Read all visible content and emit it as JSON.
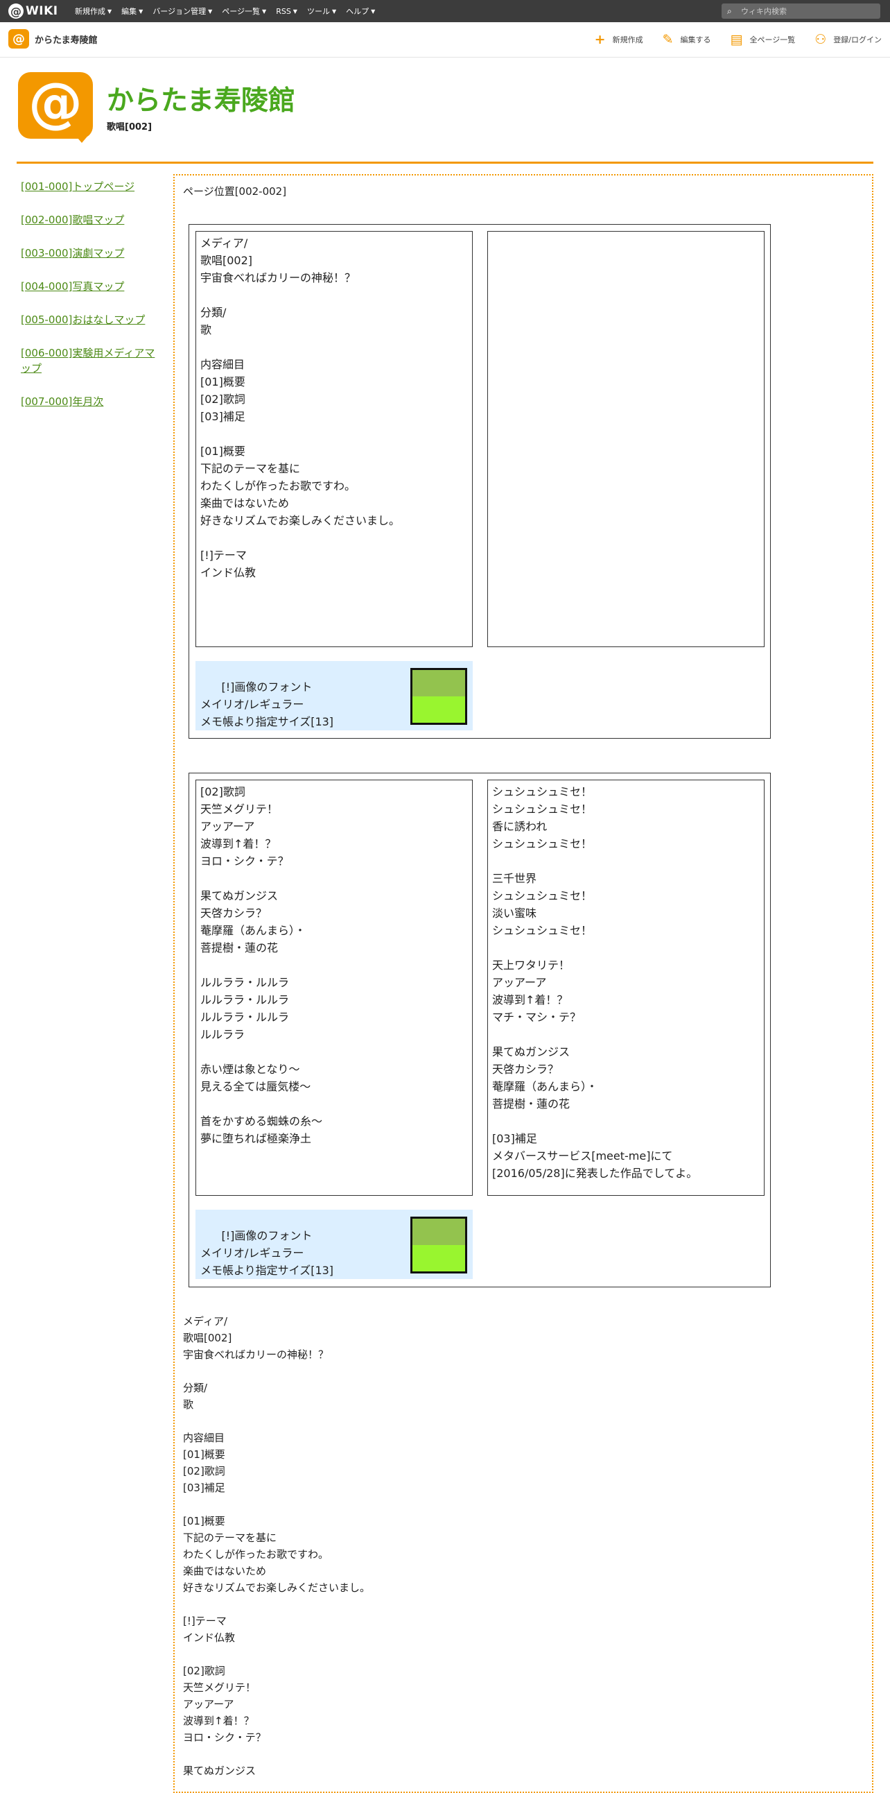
{
  "topbar": {
    "logo_symbol": "@",
    "logo_text": "WIKI",
    "menu": [
      "新規作成",
      "編集",
      "バージョン管理",
      "ページ一覧",
      "RSS",
      "ツール",
      "ヘルプ"
    ],
    "search_placeholder": "ウィキ内検索"
  },
  "subbar": {
    "site_name": "からたま寿陵館",
    "actions": [
      {
        "icon": "plus-icon",
        "label": "新規作成"
      },
      {
        "icon": "pencil-icon",
        "label": "編集する"
      },
      {
        "icon": "document-icon",
        "label": "全ページ一覧"
      },
      {
        "icon": "user-add-icon",
        "label": "登録/ログイン"
      }
    ]
  },
  "header": {
    "title": "からたま寿陵館",
    "subtitle": "歌唱[002]"
  },
  "sidebar": {
    "items": [
      "[001-000]トップページ",
      "[002-000]歌唱マップ",
      "[003-000]演劇マップ",
      "[004-000]写真マップ",
      "[005-000]おはなしマップ",
      "[006-000]実験用メディアマップ",
      "[007-000]年月次"
    ]
  },
  "main": {
    "position": "ページ位置[002-002]",
    "panel1": {
      "left": "メディア/\n歌唱[002]\n宇宙食べればカリーの神秘！？\n\n分類/\n歌\n\n内容細目\n[01]概要\n[02]歌詞\n[03]補足\n\n[01]概要\n下記のテーマを基に\nわたくしが作ったお歌ですわ。\n楽曲ではないため\n好きなリズムでお楽しみくださいまし。\n\n[!]テーマ\nインド仏教",
      "right": "",
      "note": "[!]画像のフォント\nメイリオ/レギュラー\nメモ帳より指定サイズ[13]"
    },
    "panel2": {
      "left": "[02]歌詞\n天竺メグリテ！\nアッアーア\n波導到↑着！？\nヨロ・シク・テ？\n\n果てぬガンジス\n天啓カシラ？\n菴摩羅（あんまら）・\n菩提樹・蓮の花\n\nルルララ・ルルラ\nルルララ・ルルラ\nルルララ・ルルラ\nルルララ\n\n赤い煙は象となり～\n見える全ては蜃気楼～\n\n首をかすめる蜘蛛の糸～\n夢に堕ちれば極楽浄土",
      "right": "シュシュシュミセ！\nシュシュシュミセ！\n香に誘われ\nシュシュシュミセ！\n\n三千世界\nシュシュシュミセ！\n淡い蜜味\nシュシュシュミセ！\n\n天上ワタリテ！\nアッアーア\n波導到↑着！？\nマチ・マシ・テ？\n\n果てぬガンジス\n天啓カシラ？\n菴摩羅（あんまら）・\n菩提樹・蓮の花\n\n[03]補足\nメタバースサービス[meet-me]にて\n[2016/05/28]に発表した作品でしてよ。",
      "note": "[!]画像のフォント\nメイリオ/レギュラー\nメモ帳より指定サイズ[13]"
    },
    "plain_text": "メディア/\n歌唱[002]\n宇宙食べればカリーの神秘！？\n\n分類/\n歌\n\n内容細目\n[01]概要\n[02]歌詞\n[03]補足\n\n[01]概要\n下記のテーマを基に\nわたくしが作ったお歌ですわ。\n楽曲ではないため\n好きなリズムでお楽しみくださいまし。\n\n[!]テーマ\nインド仏教\n\n[02]歌詞\n天竺メグリテ！\nアッアーア\n波導到↑着！？\nヨロ・シク・テ？\n\n果てぬガンジス"
  },
  "colors": {
    "accent": "#f39800",
    "title_green": "#4aa81e",
    "link_green": "#4c8a16",
    "note_bg": "#dcefff",
    "swatch_top": "#93c34e",
    "swatch_bottom": "#99f52f"
  }
}
